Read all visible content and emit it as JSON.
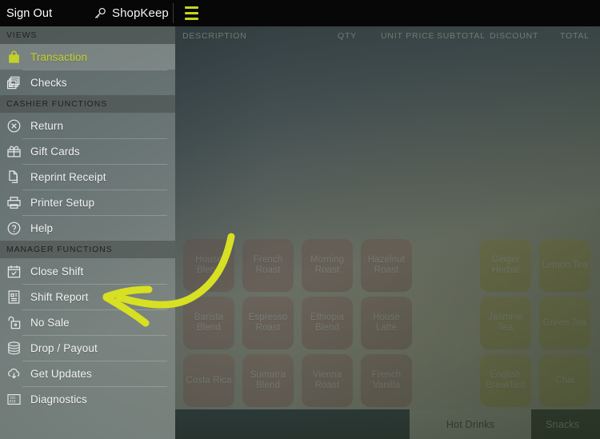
{
  "topbar": {
    "sign_out_label": "Sign Out",
    "brand_name": "ShopKeep",
    "brand_icon": "key-icon",
    "menu_icon": "hamburger-menu-icon",
    "accent_color": "#c6d421",
    "background_color": "#070707"
  },
  "sidebar": {
    "sections": [
      {
        "title": "VIEWS",
        "items": [
          {
            "label": "Transaction",
            "icon": "shopping-bag-icon",
            "active": true
          },
          {
            "label": "Checks",
            "icon": "checks-stack-icon",
            "active": false
          }
        ]
      },
      {
        "title": "CASHIER FUNCTIONS",
        "items": [
          {
            "label": "Return",
            "icon": "return-circle-x-icon",
            "active": false
          },
          {
            "label": "Gift Cards",
            "icon": "gift-card-icon",
            "active": false
          },
          {
            "label": "Reprint Receipt",
            "icon": "documents-icon",
            "active": false
          },
          {
            "label": "Printer Setup",
            "icon": "printer-icon",
            "active": false
          },
          {
            "label": "Help",
            "icon": "help-question-icon",
            "active": false
          }
        ]
      },
      {
        "title": "MANAGER FUNCTIONS",
        "items": [
          {
            "label": "Close Shift",
            "icon": "calendar-check-icon",
            "active": false
          },
          {
            "label": "Shift Report",
            "icon": "report-document-icon",
            "active": false
          },
          {
            "label": "No Sale",
            "icon": "open-lock-icon",
            "active": false
          },
          {
            "label": "Drop / Payout",
            "icon": "coins-stack-icon",
            "active": false
          },
          {
            "label": "Get Updates",
            "icon": "cloud-download-icon",
            "active": false
          },
          {
            "label": "Diagnostics",
            "icon": "binary-code-icon",
            "active": false
          }
        ]
      }
    ]
  },
  "order_table": {
    "columns": [
      {
        "label": "DESCRIPTION",
        "align": "left"
      },
      {
        "label": "QTY",
        "align": "right"
      },
      {
        "label": "UNIT PRICE",
        "align": "right"
      },
      {
        "label": "SUBTOTAL",
        "align": "right"
      },
      {
        "label": "DISCOUNT",
        "align": "right"
      },
      {
        "label": "TOTAL",
        "align": "right"
      }
    ],
    "rows": []
  },
  "product_grid": {
    "coffee_items": [
      "House Blend",
      "French Roast",
      "Morning Roast",
      "Hazelnut Roast",
      "Barista Blend",
      "Espresso Roast",
      "Ethiopia Blend",
      "House Latte",
      "Costa Rica",
      "Sumatra Blend",
      "Vienna Roast",
      "French Vanilla"
    ],
    "tea_items": [
      "Ginger Herbal",
      "Lemon Tea",
      "Jasmine Tea",
      "Green Tea",
      "English Breakfast",
      "Chai"
    ],
    "coffee_tile_color": "#c9a9a4",
    "tea_tile_color": "#d3cc84"
  },
  "tabbar": {
    "tabs": [
      {
        "label": "",
        "selected": false
      },
      {
        "label": "Hot Drinks",
        "selected": true
      },
      {
        "label": "Snacks",
        "selected": false
      }
    ]
  },
  "annotation": {
    "type": "arrow",
    "color": "#d7e022",
    "points_to": "Shift Report"
  }
}
